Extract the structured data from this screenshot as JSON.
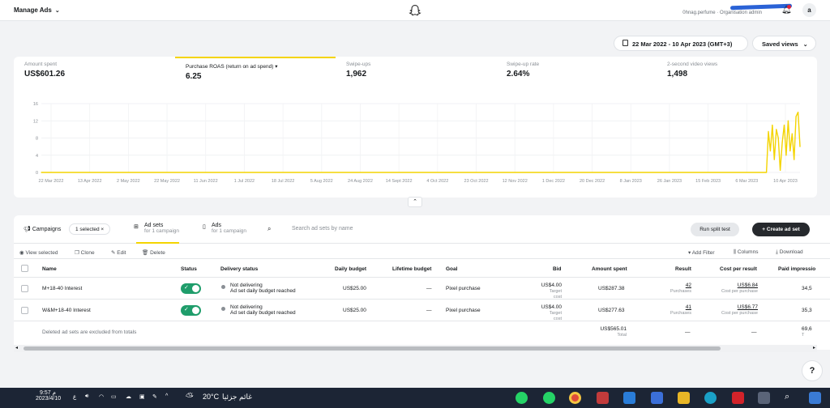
{
  "header": {
    "app_title": "Manage Ads",
    "org_label": "0hnag.perfume · Organisation admin",
    "avatar_letter": "a"
  },
  "controls": {
    "date_range": "22 Mar 2022 - 10 Apr 2023 (GMT+3)",
    "saved_views": "Saved views"
  },
  "metrics": [
    {
      "label": "Amount spent",
      "value": "US$601.26"
    },
    {
      "label": "Purchase ROAS (return on ad spend)",
      "value": "6.25"
    },
    {
      "label": "Swipe-ups",
      "value": "1,962"
    },
    {
      "label": "Swipe-up rate",
      "value": "2.64%"
    },
    {
      "label": "2-second video views",
      "value": "1,498"
    }
  ],
  "chart_data": {
    "type": "line",
    "series_color": "#f4d400",
    "y_ticks": [
      "16",
      "12",
      "8",
      "4",
      "0"
    ],
    "ylim": [
      0,
      16
    ],
    "x_ticks": [
      "22 Mar 2022",
      "13 Apr 2022",
      "2 May 2022",
      "22 May 2022",
      "11 Jun 2022",
      "1 Jul 2022",
      "18 Jul 2022",
      "5 Aug 2022",
      "24 Aug 2022",
      "14 Sept 2022",
      "4 Oct 2022",
      "23 Oct 2022",
      "12 Nov 2022",
      "1 Dec 2022",
      "20 Dec 2022",
      "8 Jan 2023",
      "26 Jan 2023",
      "15 Feb 2023",
      "6 Mar 2023",
      "10 Apr 2023"
    ],
    "x": [
      "2022-03-22",
      "2023-03-24",
      "2023-03-25",
      "2023-03-26",
      "2023-03-27",
      "2023-03-28",
      "2023-03-29",
      "2023-03-30",
      "2023-03-31",
      "2023-04-01",
      "2023-04-02",
      "2023-04-03",
      "2023-04-04",
      "2023-04-05",
      "2023-04-06",
      "2023-04-07",
      "2023-04-08",
      "2023-04-09",
      "2023-04-10"
    ],
    "values": [
      0,
      0,
      9.5,
      5,
      11,
      3,
      10,
      8,
      0.5,
      7,
      11,
      4,
      12,
      5,
      9,
      3,
      13,
      14,
      6
    ]
  },
  "tabs": {
    "campaigns": "Campaigns",
    "selected": "1 selected ×",
    "adsets": "Ad sets",
    "adsets_sub": "for 1 campaign",
    "ads": "Ads",
    "ads_sub": "for 1 campaign",
    "search_placeholder": "Search ad sets by name",
    "split_test": "Run split test",
    "create": "+  Create ad set"
  },
  "toolbar": {
    "view_selected": "View selected",
    "clone": "Clone",
    "edit": "Edit",
    "delete": "Delete",
    "add_filter": "Add Filter",
    "columns": "Columns",
    "download": "Download"
  },
  "table": {
    "headers": [
      "Name",
      "Status",
      "Delivery status",
      "Daily budget",
      "Lifetime budget",
      "Goal",
      "Bid",
      "Amount spent",
      "Result",
      "Cost per result",
      "Paid impressio"
    ],
    "rows": [
      {
        "name": "M+18-40 Interest",
        "delivery": "Not delivering",
        "delivery_sub": "Ad set daily budget reached",
        "daily_budget": "US$25.00",
        "lifetime": "—",
        "goal": "Pixel purchase",
        "bid": "US$4.00",
        "bid_sub": "Target cost",
        "spent": "US$287.38",
        "result": "42",
        "result_sub": "Purchases",
        "cpr": "US$6.84",
        "cpr_sub": "Cost per purchase",
        "impressions": "34,5"
      },
      {
        "name": "W&M+18-40 Interest",
        "delivery": "Not delivering",
        "delivery_sub": "Ad set daily budget reached",
        "daily_budget": "US$25.00",
        "lifetime": "—",
        "goal": "Pixel purchase",
        "bid": "US$4.00",
        "bid_sub": "Target cost",
        "spent": "US$277.63",
        "result": "41",
        "result_sub": "Purchases",
        "cpr": "US$6.77",
        "cpr_sub": "Cost per purchase",
        "impressions": "35,3"
      }
    ],
    "totals": {
      "note": "Deleted ad sets are excluded from totals",
      "spent": "US$565.01",
      "spent_sub": "Total",
      "result": "—",
      "cpr": "—",
      "impressions": "69,6",
      "impressions_sub": "T"
    }
  },
  "taskbar": {
    "time": "9:57",
    "ampm": "م",
    "date": "2023/4/10",
    "lang": "ع",
    "weather_temp": "20°C",
    "weather_desc": "غائم جزئيا"
  }
}
